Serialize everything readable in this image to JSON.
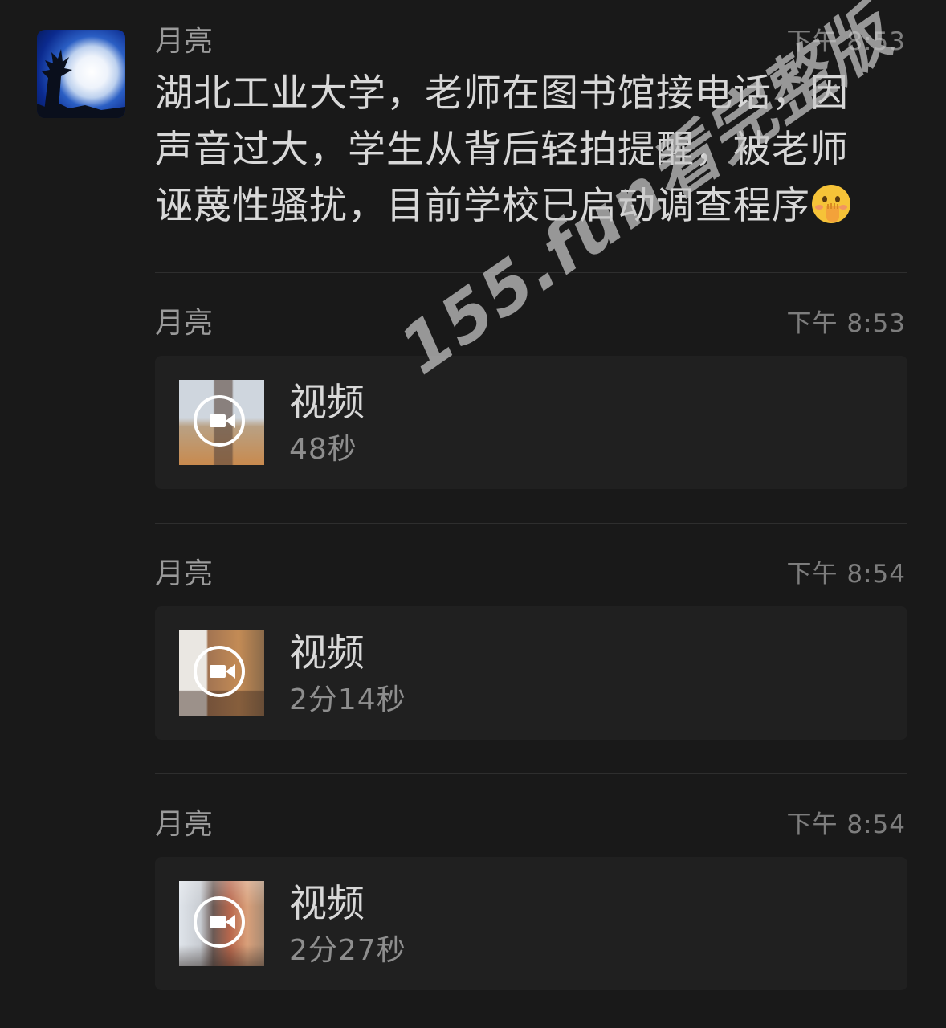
{
  "messages": [
    {
      "sender": "月亮",
      "time": "下午 8:53",
      "text": "湖北工业大学，老师在图书馆接电话，因声音过大，学生从背后轻拍提醒，被老师诬蔑性骚扰，目前学校已启动调查程序",
      "emoji": "hand-over-mouth-emoji"
    },
    {
      "sender": "月亮",
      "time": "下午 8:53",
      "video": {
        "label": "视频",
        "duration": "48秒",
        "icon": "video-camera-icon"
      }
    },
    {
      "sender": "月亮",
      "time": "下午 8:54",
      "video": {
        "label": "视频",
        "duration": "2分14秒",
        "icon": "video-camera-icon"
      }
    },
    {
      "sender": "月亮",
      "time": "下午 8:54",
      "video": {
        "label": "视频",
        "duration": "2分27秒",
        "icon": "video-camera-icon"
      }
    }
  ],
  "watermark": "155.fun看完整版",
  "colors": {
    "background": "#191919",
    "card": "#202020",
    "text": "#d8d8d8",
    "muted": "#8e8e8e"
  }
}
